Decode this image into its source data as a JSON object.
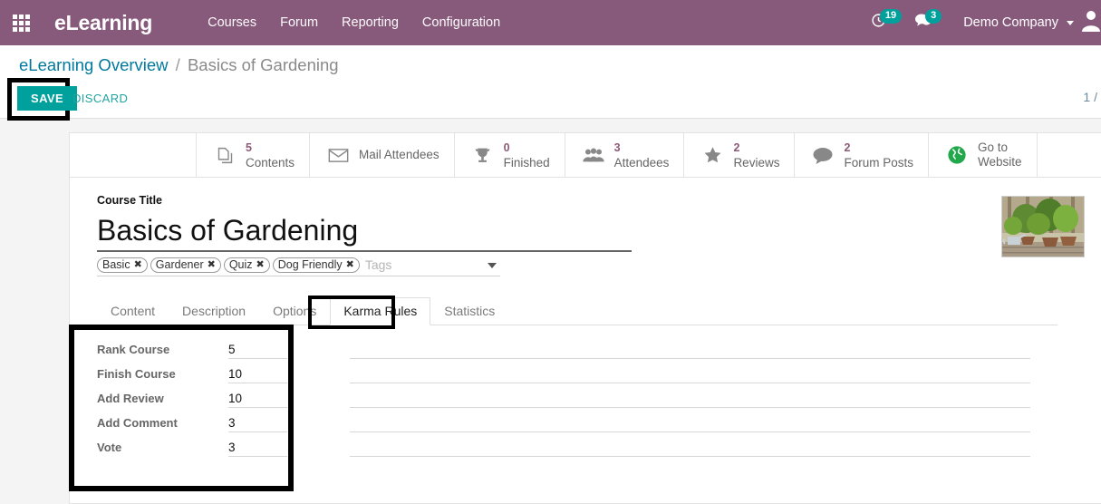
{
  "navbar": {
    "apps_icon": "apps-grid-icon",
    "brand": "eLearning",
    "menu": [
      {
        "label": "Courses"
      },
      {
        "label": "Forum"
      },
      {
        "label": "Reporting"
      },
      {
        "label": "Configuration"
      }
    ],
    "activities_icon": "clock-icon",
    "activities_count": "19",
    "messages_icon": "chat-bubble-icon",
    "messages_count": "3",
    "company": "Demo Company",
    "avatar_icon": "user-avatar-icon",
    "badge_color": "#00A09D",
    "background_color": "#875A7B"
  },
  "control_panel": {
    "breadcrumb_root": "eLearning Overview",
    "breadcrumb_separator": "/",
    "breadcrumb_current": "Basics of Gardening",
    "save_label": "SAVE",
    "discard_label": "DISCARD",
    "pager": "1 /",
    "save_color": "#00A09D"
  },
  "stat_buttons": [
    {
      "value": "5",
      "label": "Contents",
      "icon": "copy-duplicate-icon"
    },
    {
      "value": "",
      "label": "Mail Attendees",
      "icon": "envelope-icon"
    },
    {
      "value": "0",
      "label": "Finished",
      "icon": "trophy-icon"
    },
    {
      "value": "3",
      "label": "Attendees",
      "icon": "users-icon"
    },
    {
      "value": "2",
      "label": "Reviews",
      "icon": "star-icon"
    },
    {
      "value": "2",
      "label": "Forum Posts",
      "icon": "speech-bubble-icon"
    },
    {
      "value": "",
      "label": "Go to\nWebsite",
      "label_line1": "Go to",
      "label_line2": "Website",
      "icon": "globe-icon"
    }
  ],
  "form": {
    "title_field_label": "Course Title",
    "title_value": "Basics of Gardening",
    "tags": [
      {
        "label": "Basic",
        "remove": "✖"
      },
      {
        "label": "Gardener",
        "remove": "✖"
      },
      {
        "label": "Quiz",
        "remove": "✖"
      },
      {
        "label": "Dog Friendly",
        "remove": "✖"
      }
    ],
    "tags_placeholder": "Tags",
    "thumbnail_alt": "garden-potted-plants-photo"
  },
  "tabs": [
    {
      "label": "Content",
      "active": false
    },
    {
      "label": "Description",
      "active": false
    },
    {
      "label": "Options",
      "active": false
    },
    {
      "label": "Karma Rules",
      "active": true
    },
    {
      "label": "Statistics",
      "active": false
    }
  ],
  "karma_rules": [
    {
      "label": "Rank Course",
      "value": "5"
    },
    {
      "label": "Finish Course",
      "value": "10"
    },
    {
      "label": "Add Review",
      "value": "10"
    },
    {
      "label": "Add Comment",
      "value": "3"
    },
    {
      "label": "Vote",
      "value": "3"
    }
  ],
  "annotations": [
    {
      "name": "save-button-highlight"
    },
    {
      "name": "karma-rules-tab-highlight"
    },
    {
      "name": "karma-rules-fields-highlight"
    }
  ]
}
